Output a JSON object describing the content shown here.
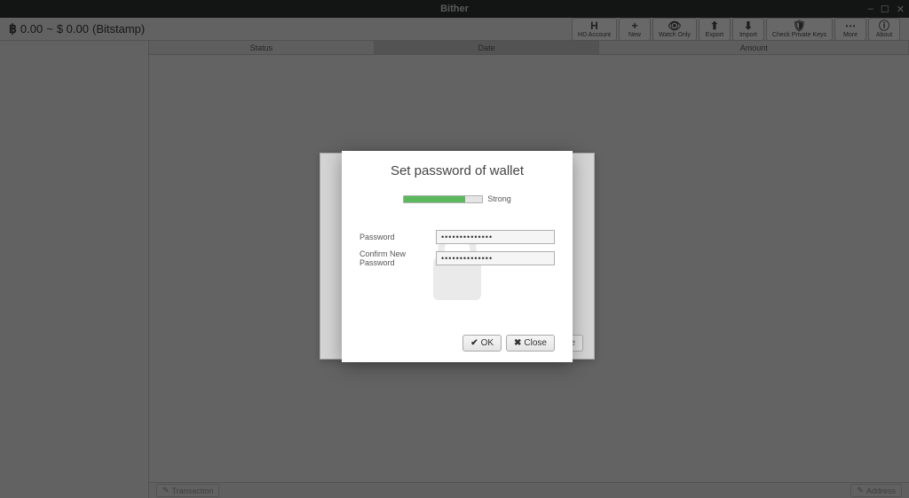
{
  "window": {
    "title": "Bither"
  },
  "header": {
    "balance_btc": "0.00",
    "balance_fiat": "$ 0.00",
    "exchange": "(Bitstamp)"
  },
  "toolbar": {
    "hd_account": "HD Account",
    "new": "New",
    "watch_only": "Watch Only",
    "export": "Export",
    "import": "Import",
    "check_keys": "Check Private Keys",
    "more": "More",
    "about": "About"
  },
  "columns": {
    "status": "Status",
    "date": "Date",
    "amount": "Amount"
  },
  "footer": {
    "transaction": "Transaction",
    "address": "Address"
  },
  "dialog": {
    "title": "Set password of wallet",
    "strength_label": "Strong",
    "password_label": "Password",
    "confirm_label": "Confirm New Password",
    "password_value": "••••••••••••••",
    "confirm_value": "••••••••••••••",
    "ok_label": "OK",
    "close_label": "Close",
    "outer_close": "se"
  }
}
